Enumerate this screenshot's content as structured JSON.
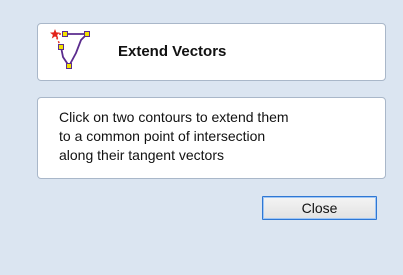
{
  "header": {
    "title": "Extend Vectors",
    "icon": "extend-vectors-icon"
  },
  "description": {
    "text": "Click on two contours to extend them\nto a common point of intersection\nalong their tangent vectors"
  },
  "actions": {
    "close_label": "Close"
  },
  "colors": {
    "background": "#dbe5f1",
    "panel_border": "#a9b7c9",
    "button_focus_border": "#2f77d3",
    "icon_line": "#5b2c8e",
    "icon_node": "#f2e200",
    "icon_star": "#e2231a"
  }
}
